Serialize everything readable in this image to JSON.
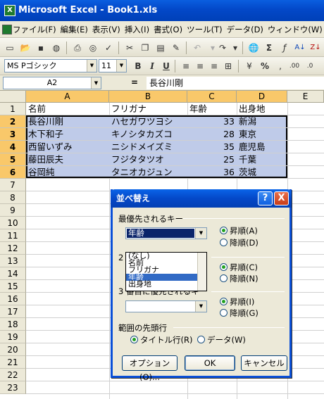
{
  "window": {
    "title": "Microsoft Excel - Book1.xls",
    "app_icon": "excel-icon"
  },
  "menu": [
    "ファイル(F)",
    "編集(E)",
    "表示(V)",
    "挿入(I)",
    "書式(O)",
    "ツール(T)",
    "データ(D)",
    "ウィンドウ(W)"
  ],
  "toolbar2": {
    "font": "MS Pゴシック",
    "size": "11",
    "bold": "B",
    "italic": "I",
    "underline": "U",
    "percent": "%"
  },
  "formula_bar": {
    "name_box": "A2",
    "equals": "=",
    "content": "長谷川剛"
  },
  "columns": [
    "A",
    "B",
    "C",
    "D",
    "E"
  ],
  "rows": [
    "1",
    "2",
    "3",
    "4",
    "5",
    "6",
    "7",
    "8",
    "9",
    "10",
    "11",
    "12",
    "13",
    "14",
    "15",
    "16",
    "17",
    "18",
    "19",
    "20",
    "21",
    "22",
    "23"
  ],
  "cells": {
    "A1": "名前",
    "B1": "フリガナ",
    "C1": "年齢",
    "D1": "出身地",
    "A2": "長谷川剛",
    "B2": "ハセガワツヨシ",
    "C2": "33",
    "D2": "新潟",
    "A3": "木下和子",
    "B3": "キノシタカズコ",
    "C3": "28",
    "D3": "東京",
    "A4": "西留いずみ",
    "B4": "ニシドメイズミ",
    "C4": "35",
    "D4": "鹿児島",
    "A5": "藤田辰夫",
    "B5": "フジタタツオ",
    "C5": "25",
    "D5": "千葉",
    "A6": "谷岡純",
    "B6": "タニオカジュン",
    "C6": "36",
    "D6": "茨城"
  },
  "dialog": {
    "title": "並べ替え",
    "help": "?",
    "close": "X",
    "key1_label": "最優先されるキー",
    "key1_value": "年齢",
    "key1_options": [
      "(なし)",
      "名前",
      "フリガナ",
      "年齢",
      "出身地"
    ],
    "key2_label_fragment": "2",
    "key3_label": "3 番目に優先されるキー",
    "asc1": "昇順(A)",
    "desc1": "降順(D)",
    "asc2": "昇順(C)",
    "desc2": "降順(N)",
    "asc3": "昇順(I)",
    "desc3": "降順(G)",
    "header_label": "範囲の先頭行",
    "header_title_row": "タイトル行(R)",
    "header_data": "データ(W)",
    "options_button": "オプション(O)...",
    "ok_button": "OK",
    "cancel_button": "キャンセル"
  }
}
